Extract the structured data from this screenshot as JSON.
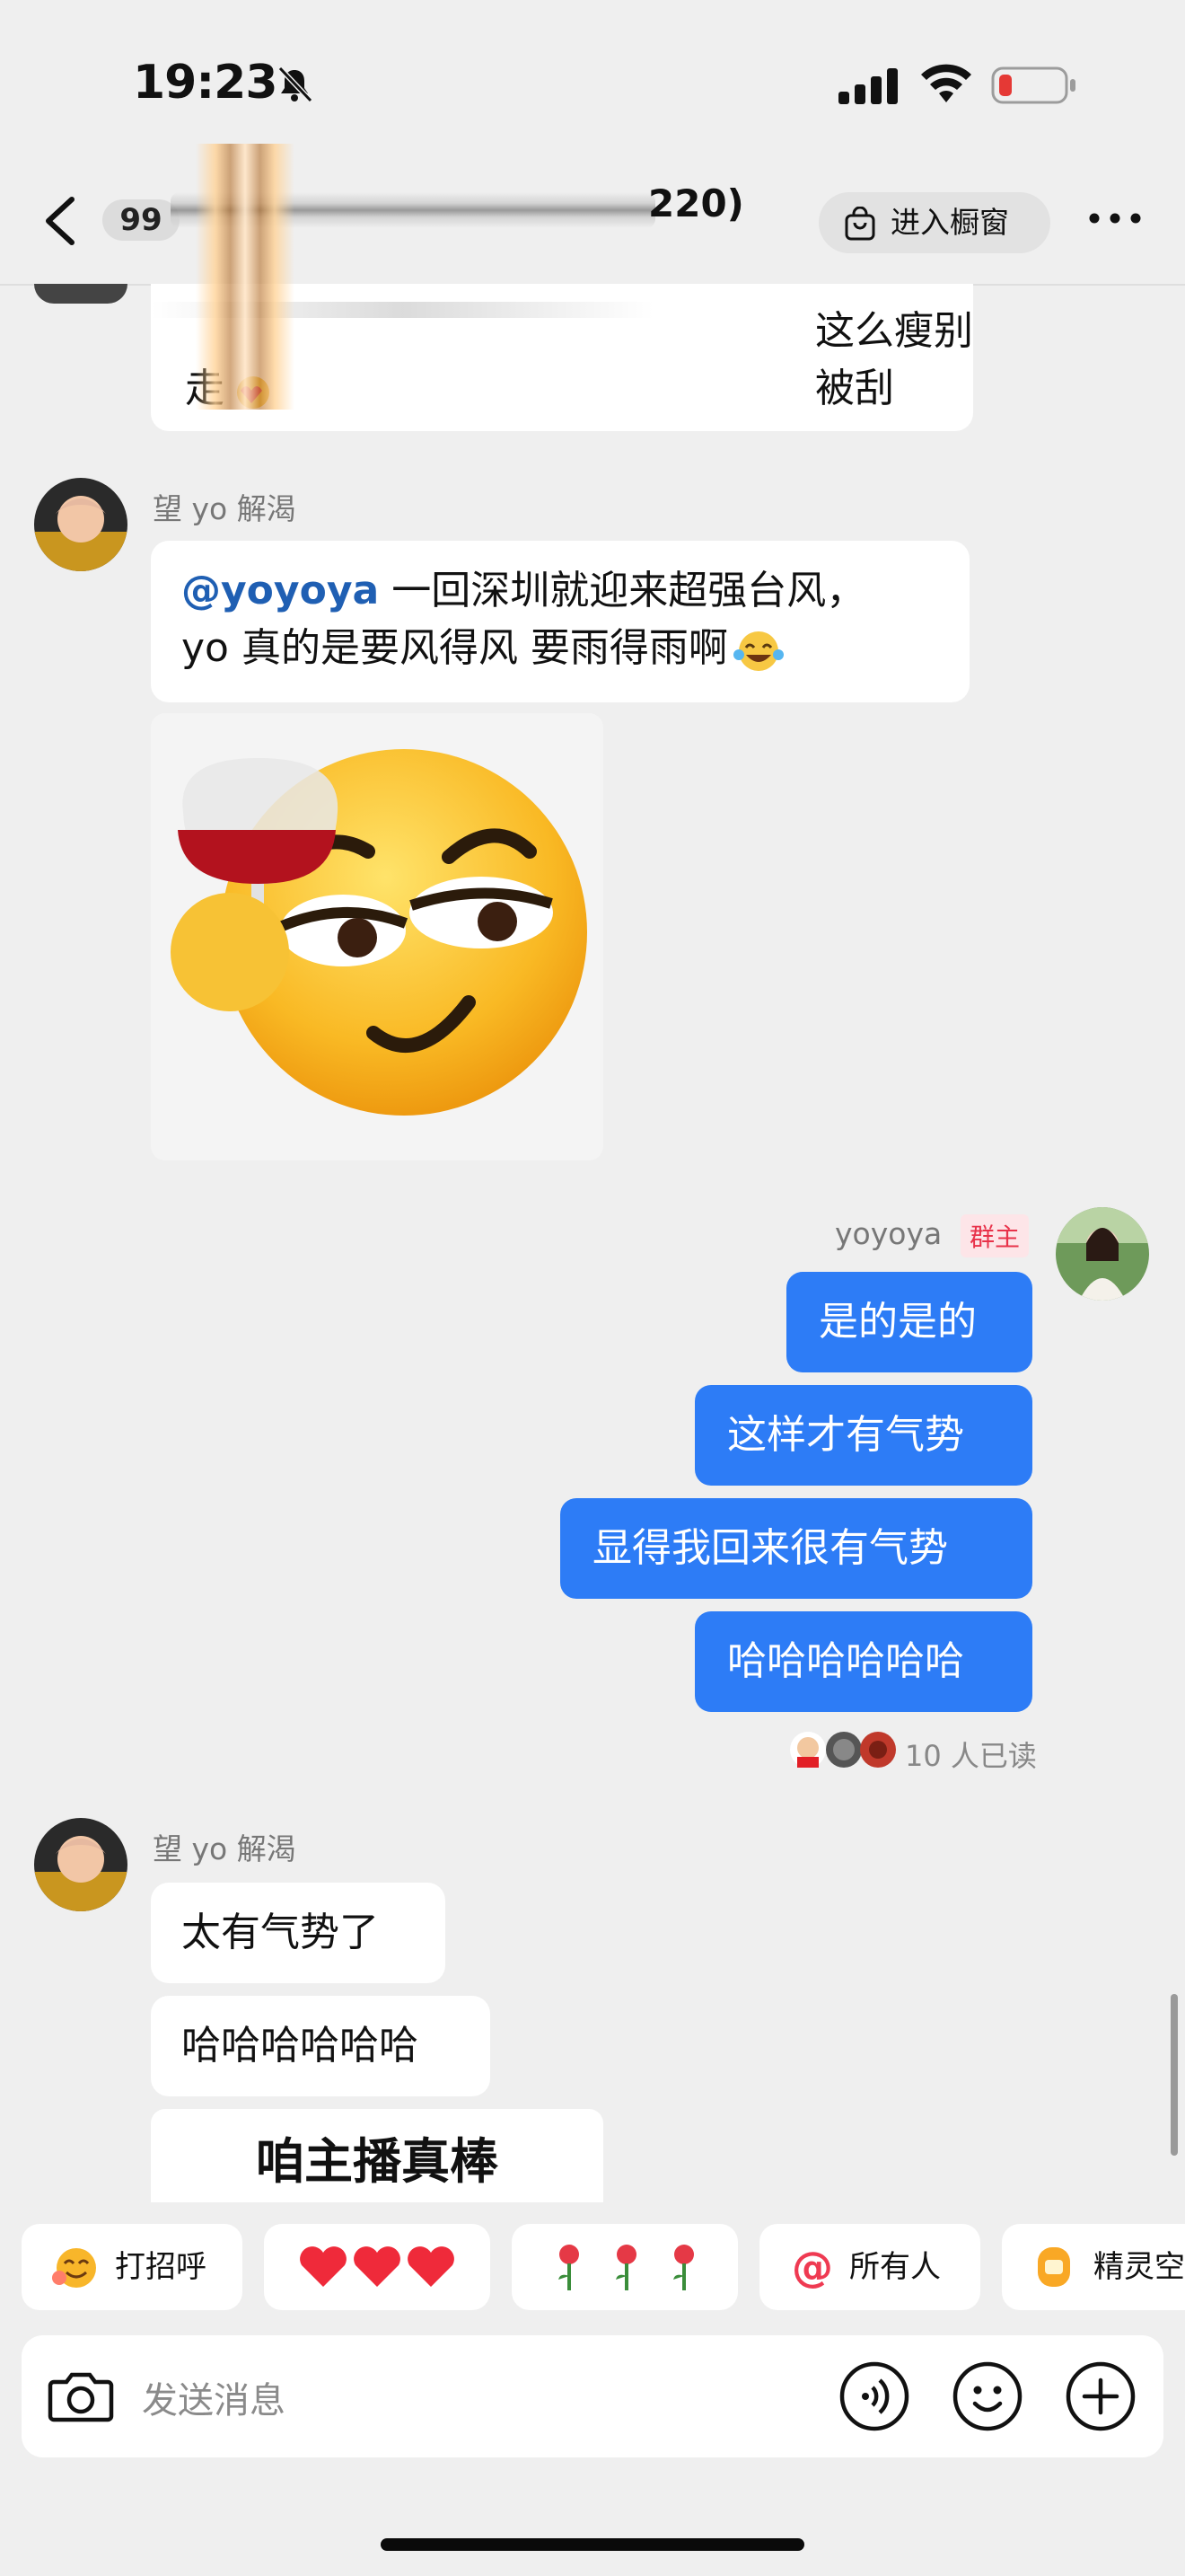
{
  "status_bar": {
    "time": "19:23",
    "icons": [
      "bell-off-icon",
      "signal-icon",
      "wifi-icon",
      "battery-low-icon"
    ],
    "battery_color": "#e53935"
  },
  "header": {
    "unread_count": "99",
    "title_visible": "220)",
    "shop_label": "进入橱窗",
    "icons": [
      "back-icon",
      "shopping-bag-icon",
      "more-icon"
    ]
  },
  "previous_message": {
    "text_line1": "这么瘦别被刮",
    "text_line2": "走"
  },
  "messages": [
    {
      "sender": "望 yo 解渴",
      "mention": "@yoyoya",
      "text_line1": " 一回深圳就迎来超强台风，",
      "text_line2": "yo 真的是要风得风 要雨得雨啊"
    },
    {
      "sender": "yoyoya",
      "role_tag": "群主",
      "bubbles": [
        "是的是的",
        "这样才有气势",
        "显得我回来很有气势",
        "哈哈哈哈哈哈"
      ],
      "read_receipt": "10 人已读"
    },
    {
      "sender": "望 yo 解渴",
      "bubbles": [
        "太有气势了",
        "哈哈哈哈哈哈"
      ],
      "sticker_text": "咱主播真棒"
    }
  ],
  "quick_replies": [
    {
      "label": "打招呼",
      "icon": "greeting-emoji-icon"
    },
    {
      "label": "",
      "icon": "three-hearts-icon"
    },
    {
      "label": "",
      "icon": "three-roses-icon"
    },
    {
      "label": "所有人",
      "icon": "at-icon"
    },
    {
      "label": "精灵空",
      "icon": "orange-box-icon"
    }
  ],
  "input": {
    "placeholder": "发送消息",
    "icons": [
      "camera-icon",
      "voice-icon",
      "emoji-icon",
      "plus-icon"
    ]
  },
  "colors": {
    "accent_blue": "#2d7cf6",
    "mention_blue": "#1f5fb3",
    "background": "#efefef",
    "owner_tag": "#e8324a"
  }
}
